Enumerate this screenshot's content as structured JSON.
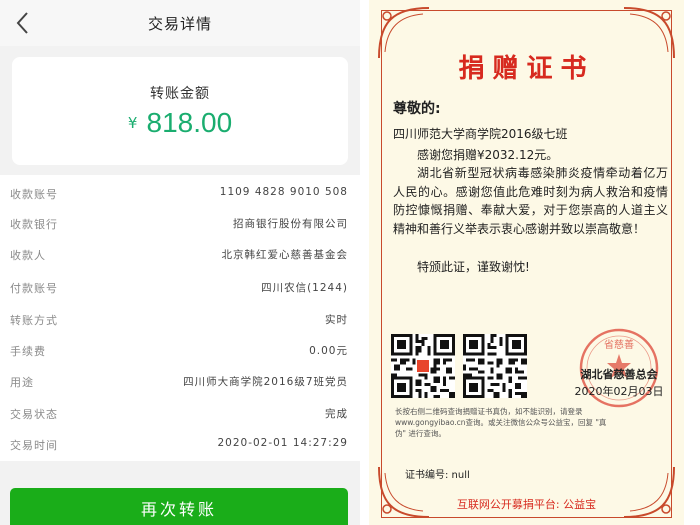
{
  "transaction": {
    "nav": {
      "title": "交易详情",
      "back_icon": "chevron-left-icon"
    },
    "amount": {
      "label": "转账金额",
      "currency": "¥",
      "value": "818.00"
    },
    "fields": [
      {
        "key": "收款账号",
        "value": "1109 4828 9010 508"
      },
      {
        "key": "收款银行",
        "value": "招商银行股份有限公司"
      },
      {
        "key": "收款人",
        "value": "北京韩红爱心慈善基金会"
      },
      {
        "key": "付款账号",
        "value": "四川农信(1244)"
      },
      {
        "key": "转账方式",
        "value": "实时"
      },
      {
        "key": "手续费",
        "value": "0.00元"
      },
      {
        "key": "用途",
        "value": "四川师大商学院2016级7班党员"
      },
      {
        "key": "交易状态",
        "value": "完成"
      },
      {
        "key": "交易时间",
        "value": "2020-02-01 14:27:29"
      }
    ],
    "again_button": "再次转账",
    "accent_color": "#1aad6f"
  },
  "certificate": {
    "title": "捐赠证书",
    "greeting": "尊敬的:",
    "recipient": "四川师范大学商学院2016级七班",
    "thanks": "感谢您捐赠¥2032.12元。",
    "body": "湖北省新型冠状病毒感染肺炎疫情牵动着亿万人民的心。感谢您值此危难时刻为病人救治和疫情防控慷慨捐赠、奉献大爱，对于您崇高的人道主义精神和善行义举表示衷心感谢并致以崇高敬意！",
    "closing": "特颁此证，谨致谢忱!",
    "org": "湖北省慈善总会",
    "date": "2020年02月03日",
    "seal_text": "省慈善",
    "notice": "长按右侧二维码查询捐赠证书真伪，如不能识别，请登录www.gongyibao.cn查询。或关注微信公众号公益宝，回复 \"真伪\" 进行查询。",
    "number": "证书编号: null",
    "footer": "互联网公开募捐平台: 公益宝",
    "title_color": "#d72a1f"
  }
}
